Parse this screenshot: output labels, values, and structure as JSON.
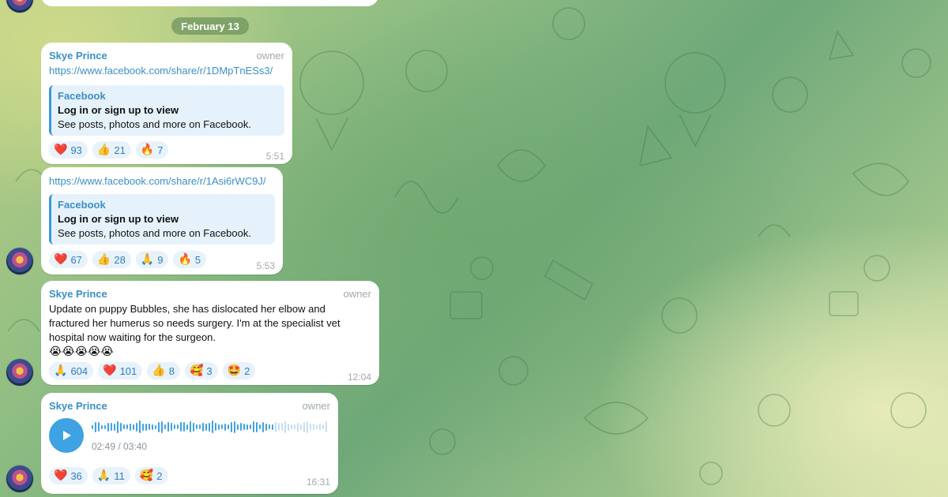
{
  "date_separator": "February 13",
  "messages": [
    {
      "sender": "Skye Prince",
      "role": "owner",
      "link": "https://www.facebook.com/share/r/1DMpTnESs3/",
      "preview": {
        "site": "Facebook",
        "title": "Log in or sign up to view",
        "description": "See posts, photos and more on Facebook."
      },
      "reactions": [
        {
          "icon": "red-heart-icon",
          "emoji": "❤️",
          "count": "93"
        },
        {
          "icon": "thumbs-up-icon",
          "emoji": "👍",
          "count": "21"
        },
        {
          "icon": "fire-icon",
          "emoji": "🔥",
          "count": "7"
        }
      ],
      "time": "5:51"
    },
    {
      "link": "https://www.facebook.com/share/r/1Asi6rWC9J/",
      "preview": {
        "site": "Facebook",
        "title": "Log in or sign up to view",
        "description": "See posts, photos and more on Facebook."
      },
      "reactions": [
        {
          "icon": "red-heart-icon",
          "emoji": "❤️",
          "count": "67"
        },
        {
          "icon": "thumbs-up-icon",
          "emoji": "👍",
          "count": "28"
        },
        {
          "icon": "folded-hands-icon",
          "emoji": "🙏",
          "count": "9"
        },
        {
          "icon": "fire-icon",
          "emoji": "🔥",
          "count": "5"
        }
      ],
      "time": "5:53"
    },
    {
      "sender": "Skye Prince",
      "role": "owner",
      "text_lines": [
        "Update on puppy Bubbles, she has dislocated her elbow and",
        "fractured her humerus so needs surgery. I'm at the specialist vet",
        "hospital now waiting for the surgeon."
      ],
      "emoji_line": "😭😭😭😭😭",
      "reactions": [
        {
          "icon": "folded-hands-icon",
          "emoji": "🙏",
          "count": "604"
        },
        {
          "icon": "red-heart-icon",
          "emoji": "❤️",
          "count": "101"
        },
        {
          "icon": "thumbs-up-icon",
          "emoji": "👍",
          "count": "8"
        },
        {
          "icon": "smiling-face-with-hearts-icon",
          "emoji": "🥰",
          "count": "3"
        },
        {
          "icon": "star-struck-icon",
          "emoji": "🤩",
          "count": "2"
        }
      ],
      "time": "12:04"
    },
    {
      "sender": "Skye Prince",
      "role": "owner",
      "voice": {
        "duration": "02:49 / 03:40",
        "progress": 0.77
      },
      "reactions": [
        {
          "icon": "red-heart-icon",
          "emoji": "❤️",
          "count": "36"
        },
        {
          "icon": "folded-hands-icon",
          "emoji": "🙏",
          "count": "11"
        },
        {
          "icon": "smiling-face-with-hearts-icon",
          "emoji": "🥰",
          "count": "2"
        }
      ],
      "time": "16:31"
    }
  ],
  "colors": {
    "accent": "#3a8fc8",
    "play": "#3ea2e3",
    "preview_bg": "#e6f2fb"
  }
}
